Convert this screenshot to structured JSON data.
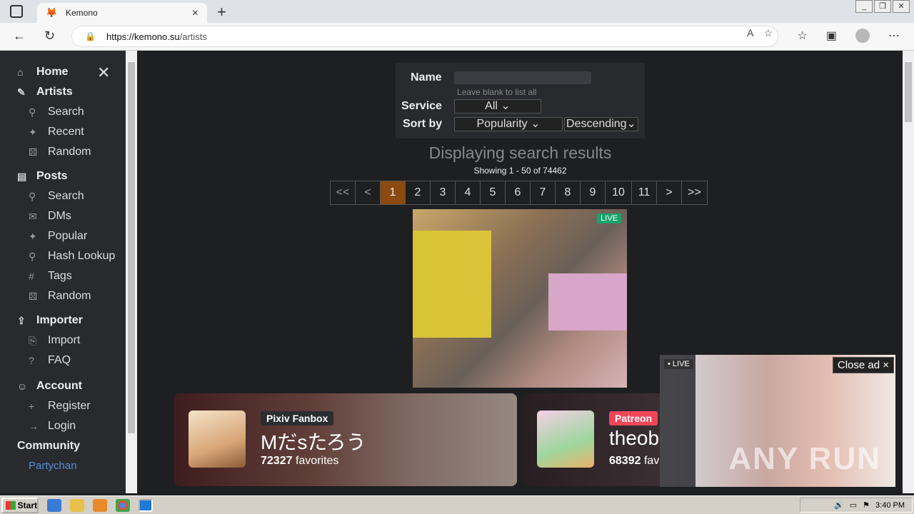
{
  "browser": {
    "tab_title": "Kemono",
    "url_host": "https://kemono.su",
    "url_path": "/artists",
    "new_tab": "+",
    "tab_close": "×"
  },
  "sidebar": {
    "home": "Home",
    "close": "✕",
    "artists": {
      "label": "Artists",
      "items": [
        "Search",
        "Recent",
        "Random"
      ]
    },
    "posts": {
      "label": "Posts",
      "items": [
        "Search",
        "DMs",
        "Popular",
        "Hash Lookup",
        "Tags",
        "Random"
      ]
    },
    "importer": {
      "label": "Importer",
      "items": [
        "Import",
        "FAQ"
      ]
    },
    "account": {
      "label": "Account",
      "items": [
        "Register",
        "Login"
      ]
    },
    "community": "Community",
    "partychan": "Partychan"
  },
  "search": {
    "name_label": "Name",
    "name_value": "",
    "name_hint": "Leave blank to list all",
    "service_label": "Service",
    "service_value": "All",
    "sort_label": "Sort by",
    "sort_value": "Popularity",
    "order_value": "Descending"
  },
  "results": {
    "title": "Displaying search results",
    "showing": "Showing 1 - 50 of 74462"
  },
  "pager": {
    "first": "<<",
    "prev": "<",
    "pages": [
      "1",
      "2",
      "3",
      "4",
      "5",
      "6",
      "7",
      "8",
      "9",
      "10",
      "11"
    ],
    "active": "1",
    "next": ">",
    "last": ">>"
  },
  "ad_top": {
    "live": "LIVE"
  },
  "cards": [
    {
      "service": "Pixiv Fanbox",
      "service_color": "#2b2d31",
      "name": "Mだsたろう",
      "favorites_count": "72327",
      "favorites_label": "favorites"
    },
    {
      "service": "Patreon",
      "service_color": "#f1465a",
      "name": "theob",
      "favorites_count": "68392",
      "favorites_label": "fav"
    }
  ],
  "ad_bottom": {
    "live": "• LIVE",
    "close": "Close ad ×",
    "watermark": "ANY RUN"
  },
  "taskbar": {
    "start": "Start",
    "time": "3:40 PM"
  }
}
